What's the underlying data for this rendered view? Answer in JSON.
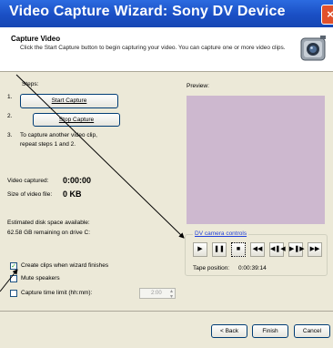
{
  "window": {
    "title": "Video Capture Wizard: Sony DV Device",
    "close_glyph": "×"
  },
  "header": {
    "title": "Capture Video",
    "description": "Click the Start Capture button to begin capturing your video. You can capture one or more video clips.",
    "icon": "webcam-icon"
  },
  "steps": {
    "label": "Steps:",
    "step1_num": "1.",
    "step2_num": "2.",
    "step3_num": "3.",
    "start_capture": "Start Capture",
    "stop_capture": "Stop Capture",
    "step3_line1": "To capture another video clip,",
    "step3_line2": "repeat steps 1 and 2."
  },
  "stats": {
    "video_captured_label": "Video captured:",
    "video_captured_value": "0:00:00",
    "size_label": "Size of video file:",
    "size_value": "0 KB",
    "disk_label": "Estimated disk space available:",
    "disk_value": "62.58 GB remaining on drive C:"
  },
  "options": {
    "create_clips": "Create clips when wizard finishes",
    "create_clips_checked": true,
    "mute_speakers": "Mute speakers",
    "mute_checked": false,
    "capture_time_limit": "Capture time limit (hh:mm):",
    "time_limit_checked": false,
    "time_value": "2:00"
  },
  "preview": {
    "label": "Preview:"
  },
  "camera": {
    "label": "DV camera controls",
    "buttons": [
      "▶",
      "❚❚",
      "■",
      "◀◀",
      "◀❚◀",
      "▶❚▶",
      "▶▶"
    ],
    "tape_position_label": "Tape position:",
    "tape_position_value": "0:00:39:14"
  },
  "footer": {
    "back": "< Back",
    "finish": "Finish",
    "cancel": "Cancel"
  }
}
